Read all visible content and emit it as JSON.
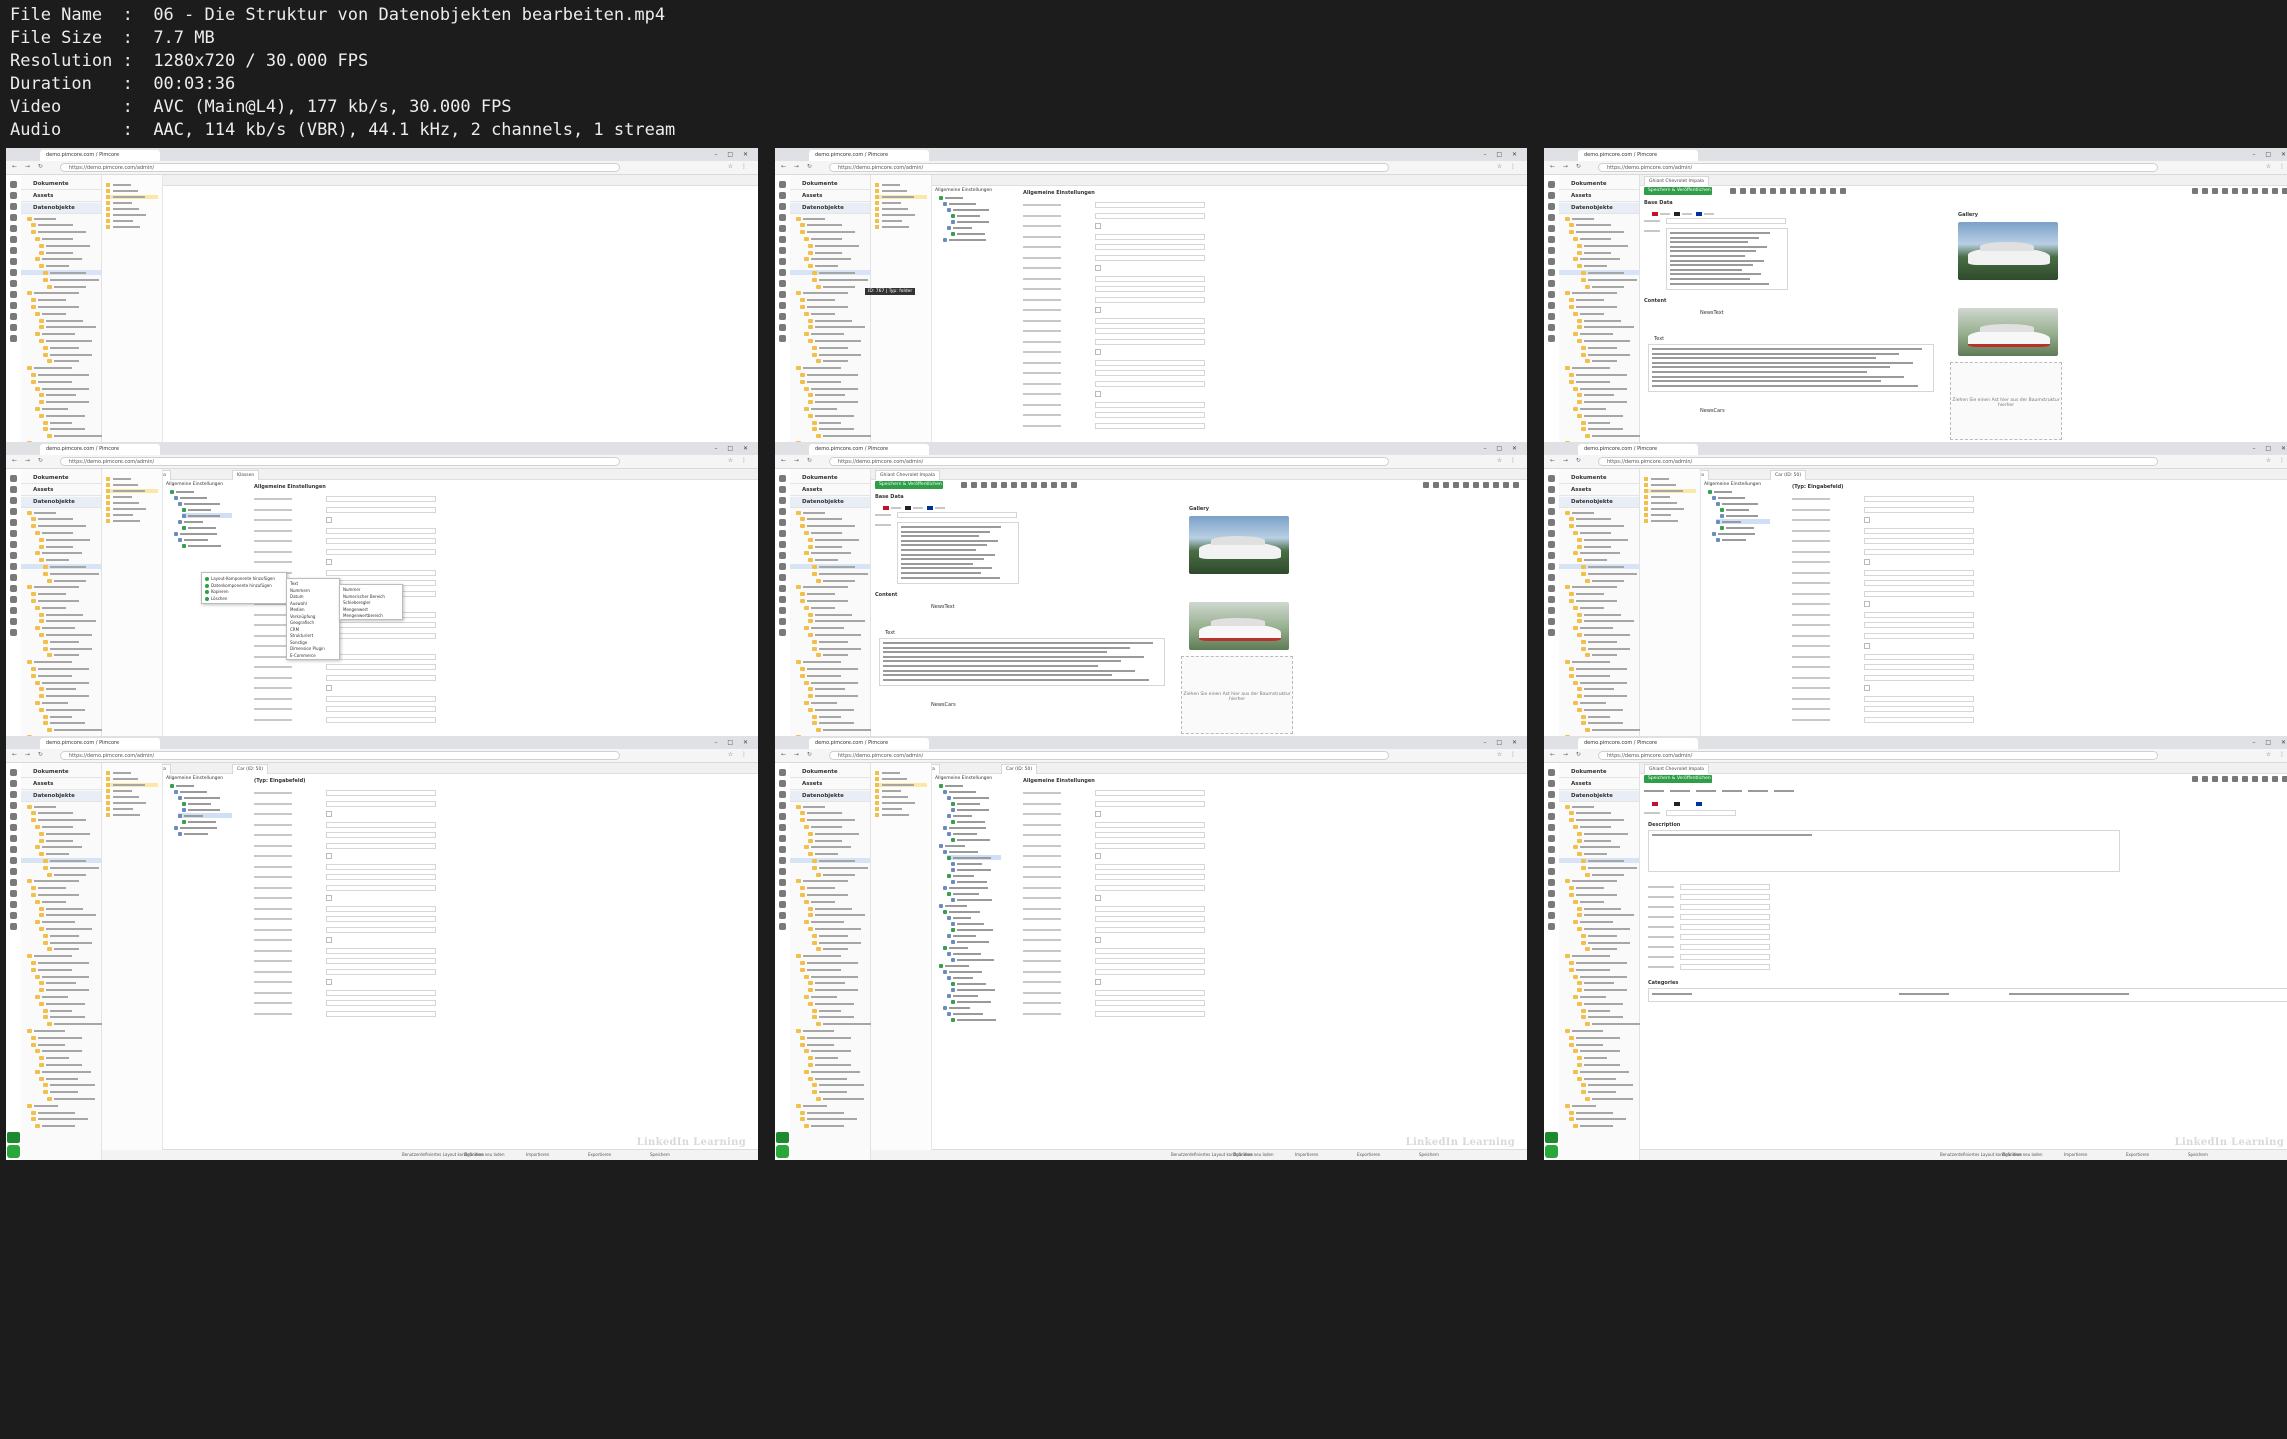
{
  "file_info": [
    {
      "label": "File Name",
      "value": "06 - Die Struktur von Datenobjekten bearbeiten.mp4"
    },
    {
      "label": "File Size",
      "value": "7.7 MB"
    },
    {
      "label": "Resolution",
      "value": "1280x720 / 30.000 FPS"
    },
    {
      "label": "Duration",
      "value": "00:03:36"
    },
    {
      "label": "Video",
      "value": "AVC (Main@L4), 177 kb/s, 30.000 FPS"
    },
    {
      "label": "Audio",
      "value": "AAC, 114 kb/s (VBR), 44.1 kHz, 2 channels, 1 stream"
    }
  ],
  "app": {
    "browser_tab": "demo.pimcore.com / Pimcore",
    "url": "https://demo.pimcore.com/admin/",
    "tree_headers": [
      "Dokumente",
      "Assets",
      "Datenobjekte"
    ],
    "watermark": "LinkedIn Learning",
    "save_button": "Speichern & Veröffentlichen",
    "object_tab": "Ghiant Chevrolet Impala",
    "class_tab": "Klassen",
    "car_tab": "Car (ID: 50)",
    "general_settings": "Allgemeine Einstellungen",
    "input_field_title": "(Typ: Eingabefeld)",
    "base_data": "Base Data",
    "content": "Content",
    "text": "Text",
    "gallery": "Gallery",
    "news_text": "NewsText",
    "news_cars": "NewsCars",
    "drop_hint": "Ziehen Sie einen Ast hier aus der Baumstruktur hierher",
    "layout_root": "Allgemeine Einstellungen",
    "description": "Description",
    "categories": "Categories",
    "tooltip": "ID: 767 | Typ: folder",
    "status_items": [
      "Benutzerdefiniertes Layout konfigurieren",
      "Definition neu laden",
      "Importieren",
      "Exportieren",
      "Speichern"
    ],
    "context_menu": [
      "Layout-Komponente hinzufügen",
      "Datenkomponente hinzufügen",
      "Kopieren",
      "Löschen"
    ],
    "submenu": [
      "Text",
      "Nummern",
      "Datum",
      "Auswahl",
      "Medien",
      "Verknüpfung",
      "Geografisch",
      "CRM",
      "Strukturiert",
      "Sonstige",
      "Dimension Plugin",
      "E-Commerce"
    ],
    "subsub": [
      "Nummer",
      "Numerischer Bereich",
      "Schieberegler",
      "Mengenwert",
      "Mengenwertbereich"
    ]
  },
  "colors": {
    "primary": "#2e9e47",
    "folder": "#f2c04a",
    "selected": "#d6e4f5"
  },
  "icons": [
    "document-icon",
    "asset-icon",
    "data-object-icon",
    "folder-icon",
    "save-icon",
    "close-icon"
  ]
}
